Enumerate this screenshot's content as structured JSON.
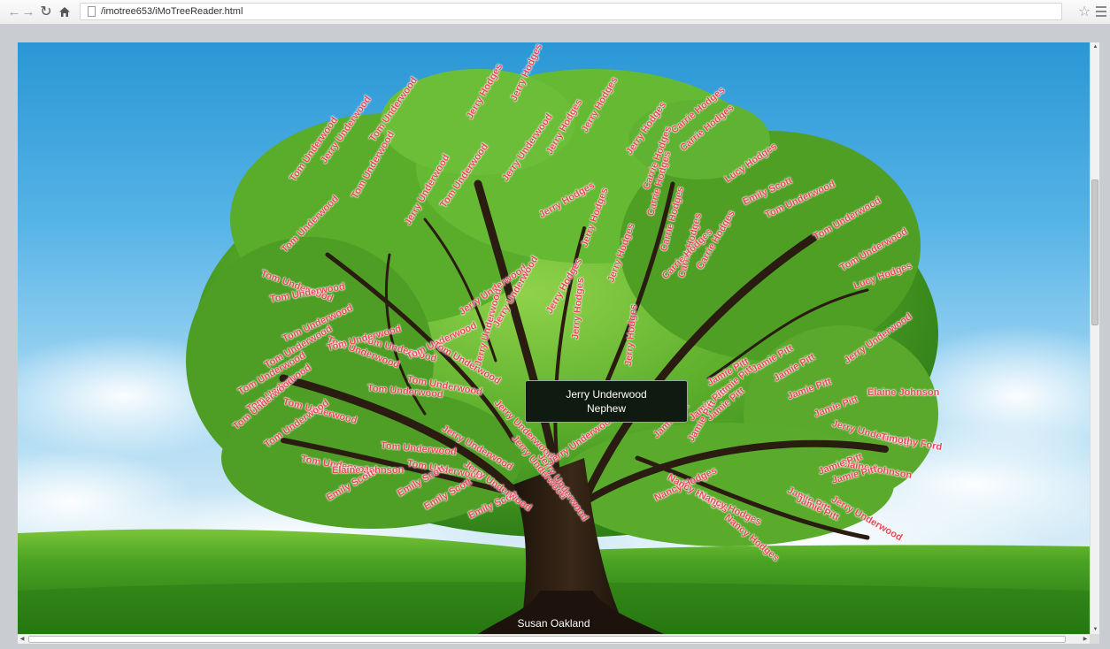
{
  "browser": {
    "url": "/imotree653/iMoTreeReader.html"
  },
  "colors": {
    "name_text": "#e84a56",
    "tooltip_bg": "#0f1a10",
    "sky_top": "#2a97d5",
    "grass": "#3f9b1c"
  },
  "icons": {
    "back": "left-arrow-icon",
    "forward": "right-arrow-icon",
    "reload": "reload-icon",
    "home": "home-icon",
    "page": "page-icon",
    "bookmark": "star-icon",
    "menu": "menu-icon"
  },
  "tooltip": {
    "name": "Jerry Underwood",
    "relation": "Nephew"
  },
  "root": {
    "name": "Susan Oakland"
  },
  "tree_labels": [
    "Tom Underwood",
    "Jerry Underwood",
    "Tom Underwood",
    "Jerry Hodges",
    "Jerry Hodges",
    "Jerry Underwood",
    "Tom Underwood",
    "Tom Underwood",
    "Tom Underwood",
    "Jerry Underwood",
    "Jerry Hodges",
    "Jerry Hodges",
    "Jerry Hodges",
    "Carrie Hodges",
    "Carrie Hodges",
    "Lucy Hodges",
    "Emily Scott",
    "Tom Underwood",
    "Tom Underwood",
    "Tom Underwood",
    "Lucy Hodges",
    "Carrie Hodges",
    "Carrie Hodges",
    "Carrie Hodges",
    "Carrie Hodges",
    "Jerry Hodges",
    "Jerry Hodges",
    "Jerry Hodges",
    "Jerry Hodges",
    "Jerry Underwood",
    "Jerry Underwood",
    "Jerry Underwood",
    "Tom Underwood",
    "Tom Underwood",
    "Tom Underwood",
    "Tom Underwood",
    "Tom Underwood",
    "Tom Underwood",
    "Tom Underwood",
    "Tom Underwood",
    "Tom Underwood",
    "Tom Underwood",
    "Tom Underwood",
    "Tom Underwood",
    "Tom Underwood",
    "Tom Underwood",
    "Tom Underwood",
    "Tom Underwood",
    "Tom Underwood",
    "Tom Underwood",
    "Tom Underwood",
    "Elaine Johnson",
    "Emily Scott",
    "Emily Scott",
    "Emily Scott",
    "Emily Scott",
    "Jerry Underwood",
    "Jerry Underwood",
    "Jerry Underwood",
    "Jerry Underwood",
    "Jerry Underwood",
    "Jerry Underwood",
    "Jamie Pitt",
    "Jamie Pitt",
    "Jamie Pitt",
    "Jamie Pitt",
    "Jamie Pitt",
    "Jamie Pitt",
    "Jamie Pitt",
    "Jamie Pitt",
    "Jerry Underwood",
    "Elaine Johnson",
    "Jerry Underwood",
    "Timothy Ford",
    "Elaine Johnson",
    "Jamie Pitt",
    "Jamie Pitt",
    "Jamie Pitt",
    "Nancy Hodges",
    "Nancy Hodges",
    "Nancy Hodges",
    "Nancy Hodges",
    "Jamie Pitt",
    "Jerry Underwood",
    "Jerry Hodges",
    "Jerry Hodges",
    "Carrie Hodges",
    "Carrie Hodges",
    "Jamie Pitt",
    "Jamie Pitt"
  ]
}
